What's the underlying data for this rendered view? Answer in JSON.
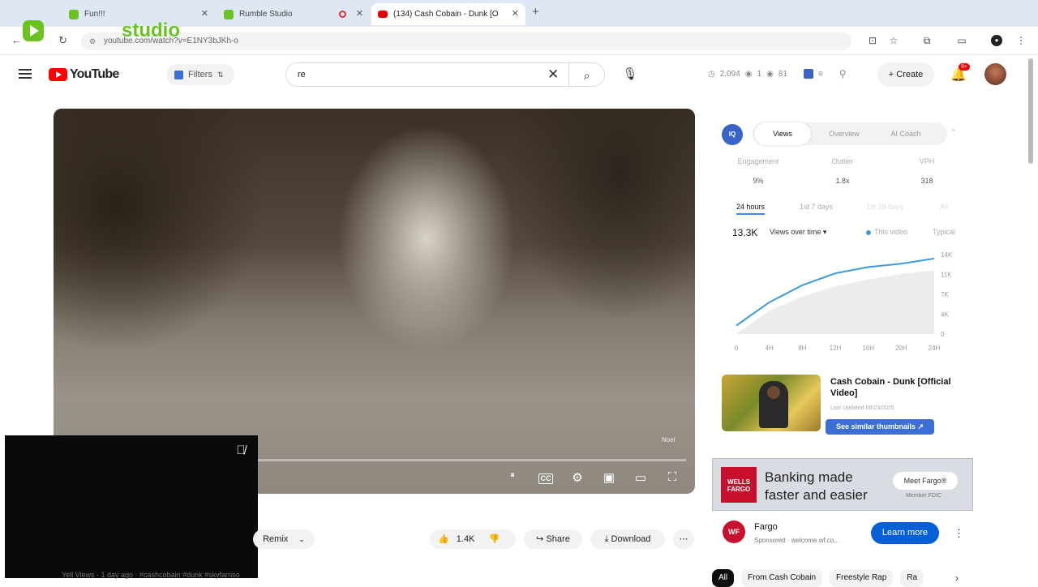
{
  "browser": {
    "tabs": [
      {
        "title": "Fun!!!",
        "favicon_color": "#6bc322"
      },
      {
        "title": "Rumble Studio",
        "favicon_color": "#6bc322"
      },
      {
        "title": "(134) Cash Cobain - Dunk [O",
        "favicon_color": "#e00000"
      }
    ],
    "url": "youtube.com/watch?v=E1NY3bJKh-o"
  },
  "overlay": {
    "studio_label": "studio"
  },
  "youtube": {
    "logo_text": "YouTube",
    "filters_label": "Filters",
    "search_value": "re",
    "stats": {
      "views": "2,094",
      "a": "1",
      "b": "81"
    },
    "create_label": "Create",
    "notif_badge": "9+"
  },
  "player": {
    "watermark": "Noel"
  },
  "actions": {
    "remix_label": "Remix",
    "likes": "1.4K",
    "share_label": "Share",
    "download_label": "Download",
    "meta_text": "Yell Views · 1 day ago · #cashcobain #dunk #skyfarriso"
  },
  "panel": {
    "iq_label": "IQ",
    "tabs": [
      "Views",
      "Overview",
      "AI Coach"
    ],
    "metrics": [
      {
        "label": "Engagement",
        "value": "9%"
      },
      {
        "label": "Outlier",
        "value": "1.8x"
      },
      {
        "label": "VPH",
        "value": "318"
      }
    ],
    "ranges": [
      "24 hours",
      "1st 7 days",
      "1st 28 days",
      "All"
    ],
    "total_views": "13.3K",
    "views_select": "Views over time ▾",
    "legend": [
      {
        "name": "This video",
        "color": "#3b9bdc"
      },
      {
        "name": "Typical",
        "color": "#cccccc"
      }
    ]
  },
  "chart_data": {
    "type": "line",
    "x": [
      "0",
      "4H",
      "8H",
      "12H",
      "16H",
      "20H",
      "24H"
    ],
    "y_ticks": [
      "0",
      "4K",
      "7K",
      "11K",
      "14K"
    ],
    "ylim": [
      0,
      14000
    ],
    "series": [
      {
        "name": "This video",
        "values": [
          1500,
          5600,
          8600,
          10700,
          11800,
          12400,
          13300
        ]
      },
      {
        "name": "Typical",
        "values": [
          0,
          4100,
          6600,
          8400,
          9600,
          10600,
          11200
        ]
      }
    ]
  },
  "video_card": {
    "title": "Cash Cobain - Dunk [Official Video]",
    "updated": "Last Updated 08/23/2025",
    "similar_label": "See similar thumbnails ↗"
  },
  "ad": {
    "brand_logo": "WELLS FARGO",
    "headline_1": "Banking made",
    "headline_2": "faster and easier",
    "meet_label": "Meet Fargo®",
    "member": "Member FDIC",
    "advertiser_icon": "WF",
    "advertiser": "Fargo",
    "sponsored": "Sponsored · welcome.wf.co...",
    "cta": "Learn more"
  },
  "chips": [
    "All",
    "From Cash Cobain",
    "Freestyle Rap",
    "Ra"
  ]
}
